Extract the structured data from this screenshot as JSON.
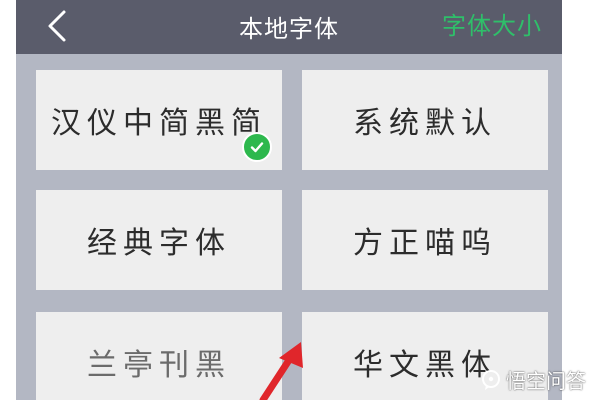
{
  "header": {
    "back_icon": "chevron-left-icon",
    "title": "本地字体",
    "action_label": "字体大小",
    "background": "#5a5c6b",
    "action_color": "#2fbf6a"
  },
  "fonts": [
    {
      "label": "汉仪中简黑简",
      "selected": true
    },
    {
      "label": "系统默认",
      "selected": false
    },
    {
      "label": "经典字体",
      "selected": false
    },
    {
      "label": "方正喵呜",
      "selected": false
    },
    {
      "label": "兰亭刊黑",
      "selected": false
    },
    {
      "label": "华文黑体",
      "selected": false
    }
  ],
  "selected_icon": "check-circle-icon",
  "selected_color": "#2db84d",
  "annotation_icon": "red-arrow-icon",
  "annotation_color": "#e0262b",
  "watermark": {
    "icon": "speech-bubble-icon",
    "text": "悟空问答"
  }
}
